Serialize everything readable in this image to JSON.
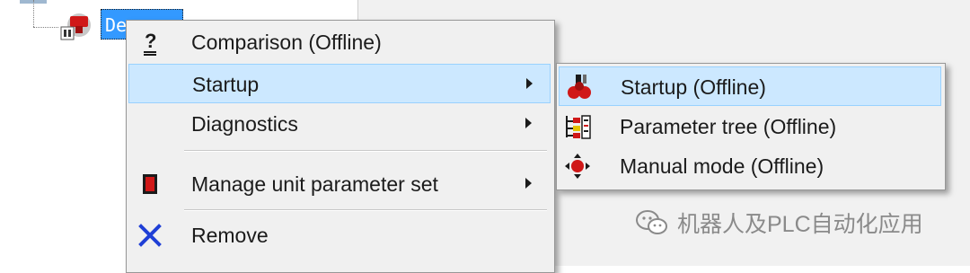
{
  "tree": {
    "device_label": "De"
  },
  "context_menu": {
    "items": [
      {
        "label": "Comparison (Offline)",
        "icon": "question-mark-icon",
        "has_submenu": false
      },
      {
        "label": "Startup",
        "icon": "",
        "has_submenu": true,
        "highlighted": true
      },
      {
        "label": "Diagnostics",
        "icon": "",
        "has_submenu": true
      },
      {
        "label": "Manage unit parameter set",
        "icon": "parameter-set-icon",
        "has_submenu": true
      },
      {
        "label": "Remove",
        "icon": "remove-x-icon",
        "has_submenu": false
      }
    ]
  },
  "submenu": {
    "items": [
      {
        "label": "Startup (Offline)",
        "icon": "startup-icon",
        "highlighted": true
      },
      {
        "label": "Parameter tree (Offline)",
        "icon": "parameter-tree-icon"
      },
      {
        "label": "Manual mode (Offline)",
        "icon": "manual-mode-icon"
      }
    ]
  },
  "watermark": {
    "text": "机器人及PLC自动化应用"
  },
  "colors": {
    "highlight_bg": "#cce8ff",
    "highlight_border": "#99d1ff",
    "selection_blue": "#3399ff",
    "remove_blue": "#1f3fd6",
    "icon_red": "#d01818"
  }
}
